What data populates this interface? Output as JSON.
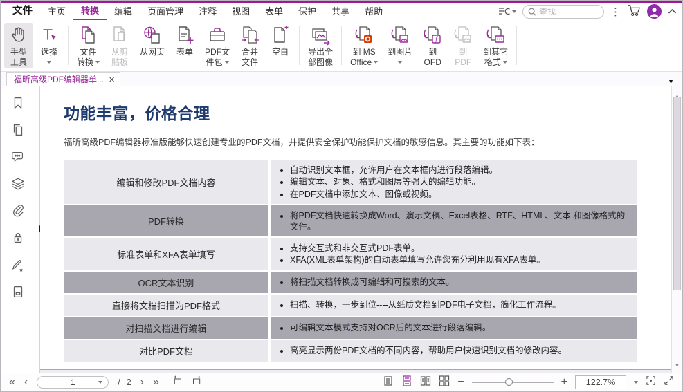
{
  "colors": {
    "accent": "#982b9b",
    "heading": "#1e3a6e",
    "office_orange": "#d83b01",
    "table_light": "#e9e8ed",
    "table_dark": "#a8a7b0"
  },
  "menu": {
    "items": [
      "文件",
      "主页",
      "转换",
      "编辑",
      "页面管理",
      "注释",
      "视图",
      "表单",
      "保护",
      "共享",
      "帮助"
    ],
    "active_item": "转换",
    "search_placeholder": "查找"
  },
  "ribbon": {
    "buttons": [
      {
        "l1": "手型",
        "l2": "工具"
      },
      {
        "l1": "选择",
        "l2": ""
      },
      {
        "l1": "文件",
        "l2": "转换"
      },
      {
        "l1": "从剪",
        "l2": "贴板"
      },
      {
        "l1": "从网页",
        "l2": ""
      },
      {
        "l1": "表单",
        "l2": ""
      },
      {
        "l1": "PDF文",
        "l2": "件包"
      },
      {
        "l1": "合并",
        "l2": "文件"
      },
      {
        "l1": "空白",
        "l2": ""
      },
      {
        "l1": "导出全",
        "l2": "部图像"
      },
      {
        "l1": "到 MS",
        "l2": "Office"
      },
      {
        "l1": "到图片",
        "l2": ""
      },
      {
        "l1": "到",
        "l2": "OFD"
      },
      {
        "l1": "到",
        "l2": "PDF"
      },
      {
        "l1": "到其它",
        "l2": "格式"
      }
    ]
  },
  "tab_bar": {
    "document_tab": "福昕高级PDF编辑器单..."
  },
  "sidebar": {
    "icons": [
      "bookmark",
      "pages",
      "comments",
      "layers",
      "attachments",
      "security",
      "signature",
      "field"
    ]
  },
  "document": {
    "heading": "功能丰富，价格合理",
    "intro": "福昕高级PDF编辑器标准版能够快速创建专业的PDF文档，并提供安全保护功能保护文档的敏感信息。其主要的功能如下表：",
    "table": {
      "rows": [
        {
          "feature": "编辑和修改PDF文档内容",
          "details": [
            "自动识别文本框，允许用户在文本框内进行段落编辑。",
            "编辑文本、对象、格式和图层等强大的编辑功能。",
            "在PDF文档中添加文本、图像或视频。"
          ]
        },
        {
          "feature": "PDF转换",
          "details": [
            "将PDF文档快速转换成Word、演示文稿、Excel表格、RTF、HTML、文本 和图像格式的文件。"
          ]
        },
        {
          "feature": "标准表单和XFA表单填写",
          "details": [
            "支持交互式和非交互式PDF表单。",
            "XFA(XML表单架构)的自动表单填写允许您充分利用现有XFA表单。"
          ]
        },
        {
          "feature": "OCR文本识别",
          "details": [
            "将扫描文档转换成可编辑和可搜索的文本。"
          ]
        },
        {
          "feature": "直接将文档扫描为PDF格式",
          "details": [
            "扫描、转换，一步到位----从纸质文档到PDF电子文档，简化工作流程。"
          ]
        },
        {
          "feature": "对扫描文档进行编辑",
          "details": [
            "可编辑文本模式支持对OCR后的文本进行段落编辑。"
          ]
        },
        {
          "feature": "对比PDF文档",
          "details": [
            "高亮显示两份PDF文档的不同内容，帮助用户快速识别文档的修改内容。"
          ]
        }
      ]
    }
  },
  "status_bar": {
    "page_current": "1",
    "page_separator": "/",
    "page_total": "2",
    "zoom_value": "122.7%"
  }
}
